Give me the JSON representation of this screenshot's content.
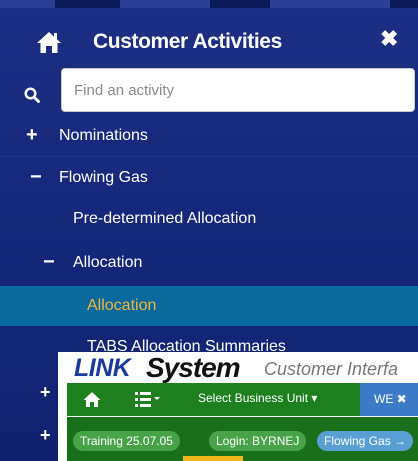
{
  "sidebar": {
    "title": "Customer Activities",
    "search_placeholder": "Find an activity",
    "items": [
      {
        "toggle": "+",
        "label": "Nominations"
      },
      {
        "toggle": "−",
        "label": "Flowing Gas"
      },
      {
        "label": "Pre-determined Allocation"
      },
      {
        "toggle": "−",
        "label": "Allocation"
      },
      {
        "label": "Allocation"
      },
      {
        "label": "TABS Allocation Summaries"
      }
    ],
    "hidden_toggles": [
      "+",
      "+"
    ]
  },
  "overlay": {
    "brand_link": "LINK",
    "brand_system": "System",
    "brand_sub": "Customer Interfa",
    "nav": {
      "select_bu": "Select Business Unit ▾",
      "we_tab": "WE ✖"
    },
    "pills": [
      "Training 25.07.05",
      "Login: BYRNEJ",
      "Flowing Gas →"
    ]
  },
  "icons": {
    "home": "home-icon",
    "close": "close-icon",
    "search": "search-icon",
    "menu": "list-menu-icon"
  },
  "colors": {
    "sidebar_bg": "#1c2f84",
    "selected_bg": "#0a6a9e",
    "selected_text": "#f2b53c",
    "nav_green": "#1e7f1e",
    "we_blue": "#3d7bc7"
  }
}
